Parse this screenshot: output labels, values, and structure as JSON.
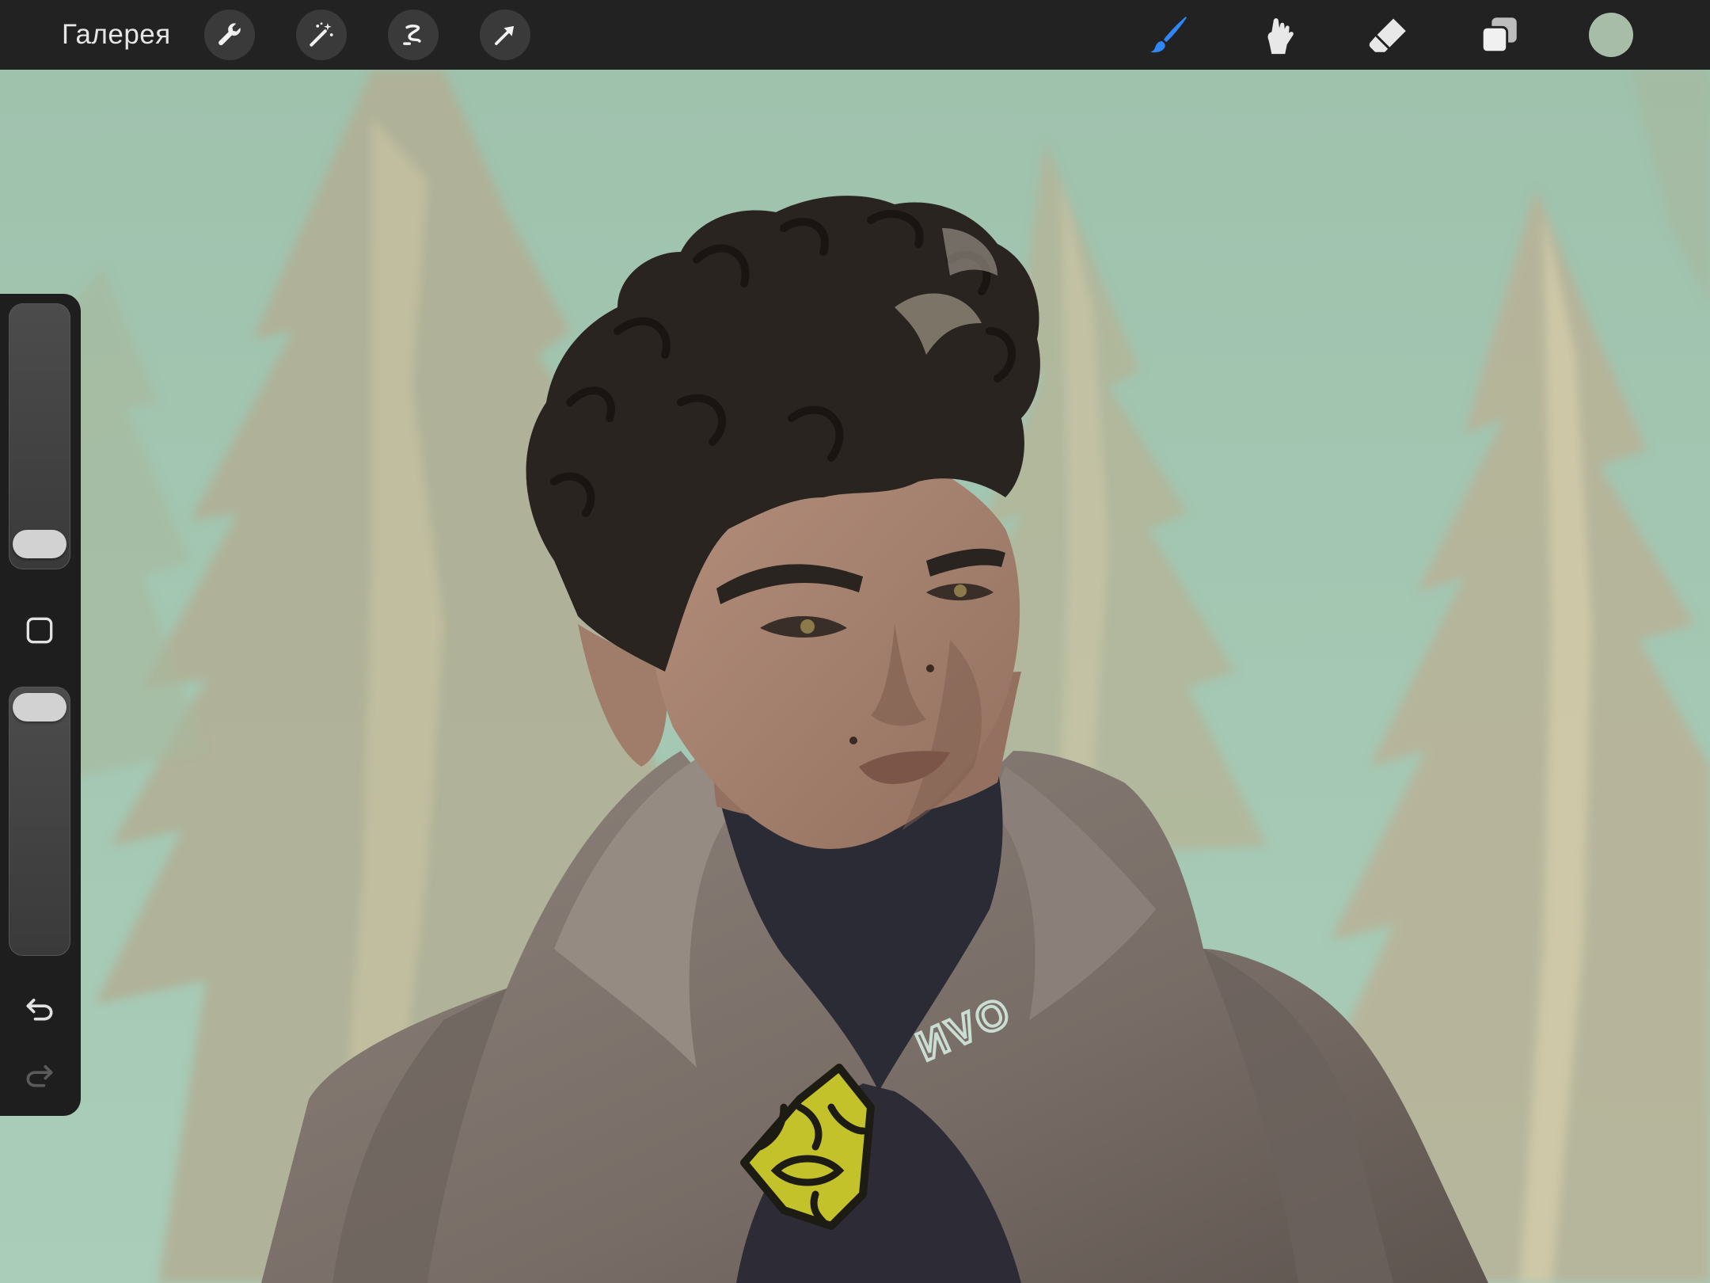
{
  "toolbar": {
    "gallery_label": "Галерея",
    "left_tools": [
      "wrench-icon",
      "magic-wand-icon",
      "selection-icon",
      "transform-arrow-icon"
    ],
    "right_tools": [
      "brush-icon",
      "smudge-icon",
      "eraser-icon",
      "layers-icon"
    ],
    "active_tool": "brush",
    "active_color": "#a8bda8",
    "accent_color": "#2f86f6"
  },
  "sidebar": {
    "brush_size_level": 0.12,
    "opacity_level": 0.92,
    "icons": [
      "modify-square-icon",
      "undo-icon",
      "redo-icon"
    ]
  },
  "canvas": {
    "signature": "ИVO",
    "palette": {
      "background": "#a7c6b3",
      "trees": "#b5b197",
      "skin": "#a68270",
      "hair": "#2a2421",
      "cloak": "#7e736c",
      "collar": "#2b2b35",
      "brooch": "#c4c22a"
    }
  }
}
